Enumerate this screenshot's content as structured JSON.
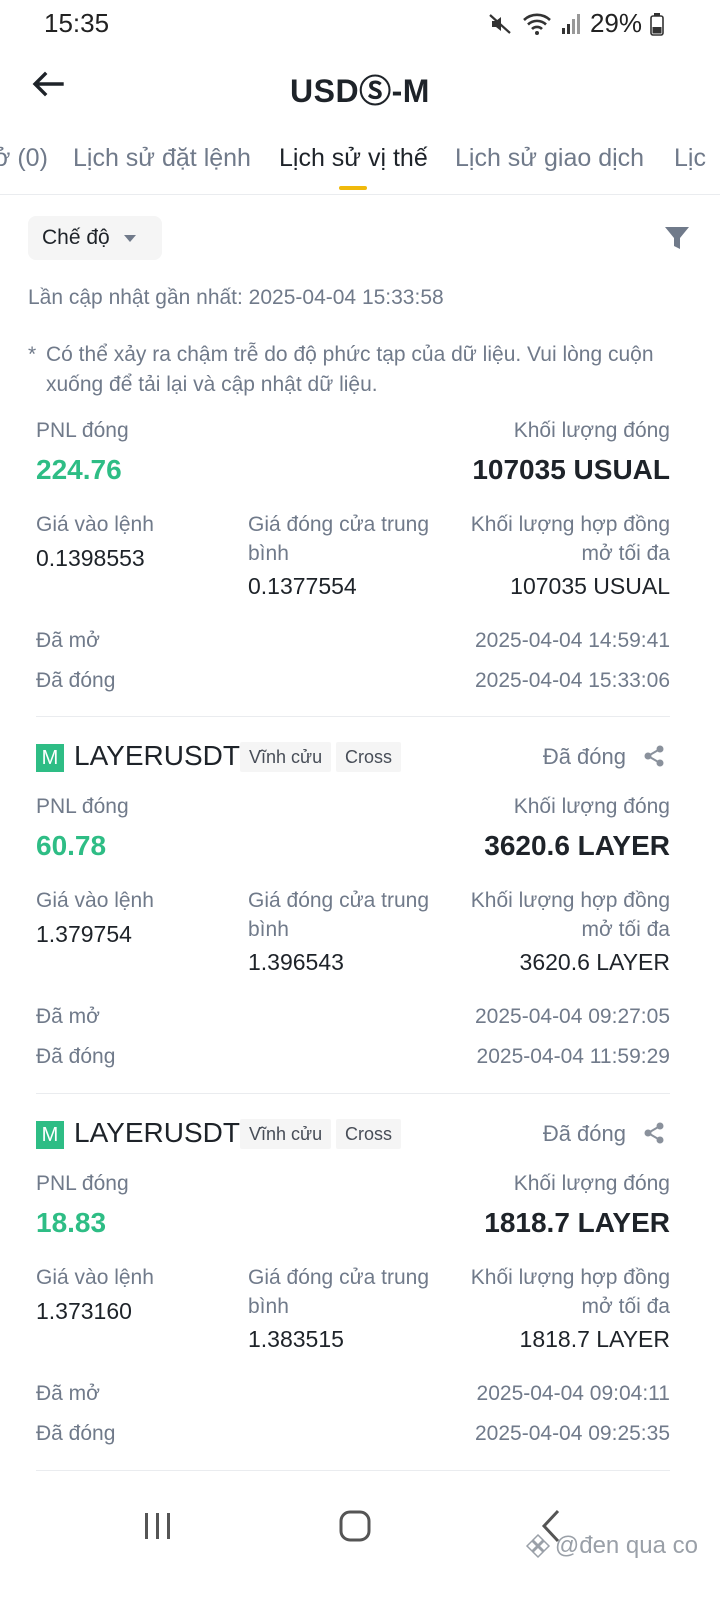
{
  "status_bar": {
    "time": "15:35",
    "battery": "29%"
  },
  "header": {
    "title": "USDⓈ-M"
  },
  "tabs": [
    {
      "label": "ở (0)"
    },
    {
      "label": "Lịch sử đặt lệnh"
    },
    {
      "label": "Lịch sử vị thế"
    },
    {
      "label": "Lịch sử giao dịch"
    },
    {
      "label": "Lịc"
    }
  ],
  "filter": {
    "mode_label": "Chế độ"
  },
  "last_updated": "Lần cập nhật gần nhất: 2025-04-04 15:33:58",
  "note": {
    "star": "*",
    "text": "Có thể xảy ra chậm trễ do độ phức tạp của dữ liệu. Vui lòng cuộn xuống để tải lại và cập nhật dữ liệu."
  },
  "labels": {
    "pnl": "PNL đóng",
    "closed_volume": "Khối lượng đóng",
    "entry_price": "Giá vào lệnh",
    "avg_close_price": "Giá đóng cửa trung bình",
    "max_open_contracts": "Khối lượng hợp đồng mở tối đa",
    "opened": "Đã mở",
    "closed": "Đã đóng"
  },
  "positions": [
    {
      "pnl": "224.76",
      "closed_volume": "107035 USUAL",
      "entry_price": "0.1398553",
      "avg_close_price": "0.1377554",
      "max_open": "107035 USUAL",
      "opened_at": "2025-04-04 14:59:41",
      "closed_at": "2025-04-04 15:33:06"
    },
    {
      "badge": "M",
      "symbol": "LAYERUSDT",
      "tag1": "Vĩnh cửu",
      "tag2": "Cross",
      "status": "Đã đóng",
      "pnl": "60.78",
      "closed_volume": "3620.6 LAYER",
      "entry_price": "1.379754",
      "avg_close_price": "1.396543",
      "max_open": "3620.6 LAYER",
      "opened_at": "2025-04-04 09:27:05",
      "closed_at": "2025-04-04 11:59:29"
    },
    {
      "badge": "M",
      "symbol": "LAYERUSDT",
      "tag1": "Vĩnh cửu",
      "tag2": "Cross",
      "status": "Đã đóng",
      "pnl": "18.83",
      "closed_volume": "1818.7 LAYER",
      "entry_price": "1.373160",
      "avg_close_price": "1.383515",
      "max_open": "1818.7 LAYER",
      "opened_at": "2025-04-04 09:04:11",
      "closed_at": "2025-04-04 09:25:35"
    }
  ],
  "watermark": "@đen qua co",
  "colors": {
    "profit": "#2ebd85",
    "accent": "#f0b90b",
    "muted": "#707a8a"
  }
}
